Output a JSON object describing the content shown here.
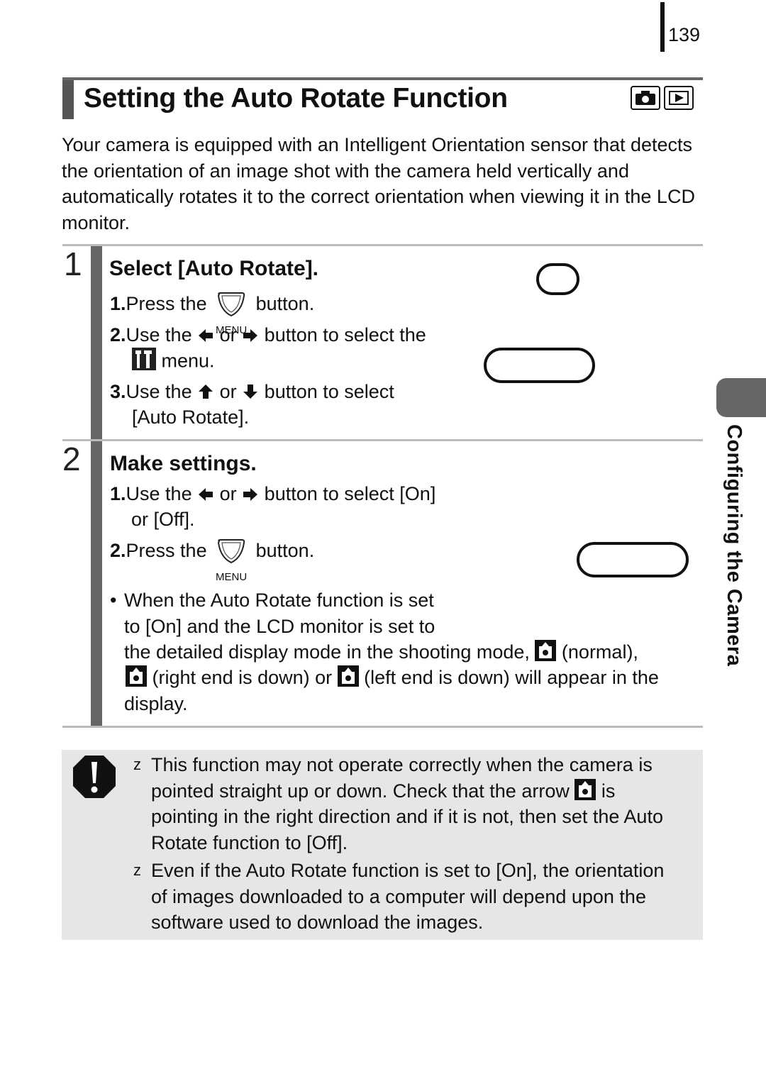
{
  "page": {
    "number": "139",
    "title": "Setting the Auto Rotate Function",
    "mode_icons": [
      "camera-icon",
      "playback-icon"
    ],
    "intro": "Your camera is equipped with an Intelligent Orientation sensor that detects the orientation of an image shot with the camera held vertically and automatically rotates it to the correct orientation when viewing it in the LCD monitor.",
    "side_tab_label": "Configuring the Camera"
  },
  "steps": [
    {
      "number": "1",
      "title": "Select [Auto Rotate].",
      "items": [
        {
          "num": "1.",
          "pre": "Press the",
          "icon": "menu-button-icon",
          "icon_label": "MENU",
          "post": "button."
        },
        {
          "num": "2.",
          "pre": "Use the",
          "a": "or",
          "post": "button to select the",
          "cont": "menu."
        },
        {
          "num": "3.",
          "pre": "Use the",
          "a": "or",
          "post": "button to select",
          "cont": "[Auto Rotate]."
        }
      ]
    },
    {
      "number": "2",
      "title": "Make settings.",
      "items": [
        {
          "num": "1.",
          "pre": "Use the",
          "a": "or",
          "post": "button to select [On]",
          "cont": "or [Off]."
        },
        {
          "num": "2.",
          "pre": "Press the",
          "icon": "menu-button-icon",
          "icon_label": "MENU",
          "post": "button."
        }
      ],
      "note": {
        "bullet": "•",
        "line1": "When the Auto Rotate function is set",
        "line2": "to [On] and the LCD monitor is set to",
        "line3a": "the detailed display mode in the shooting mode,",
        "line3b": "(normal),",
        "line4a": "(right end is down) or",
        "line4b": "(left end is down) will appear in the",
        "line5": "display."
      }
    }
  ],
  "caution": {
    "icon": "caution-icon",
    "bullet": "z",
    "items": [
      {
        "line1": "This function may not operate correctly when the camera is",
        "line2a": "pointed straight up or down. Check that the arrow",
        "line2b": "is",
        "line3": "pointing in the right direction and if it is not, then set the Auto",
        "line4": "Rotate function to [Off]."
      },
      {
        "line1": "Even if the Auto Rotate function is set to [On], the orientation",
        "line2": "of images downloaded to a computer will depend upon the",
        "line3": "software used to download the images."
      }
    ]
  }
}
